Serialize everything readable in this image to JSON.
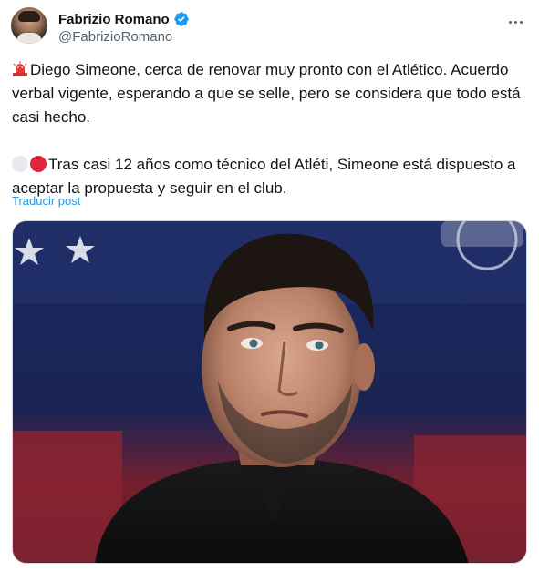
{
  "author": {
    "display_name": "Fabrizio Romano",
    "handle": "@FabrizioRomano",
    "verified": true
  },
  "tweet": {
    "paragraph_1": "Diego Simeone, cerca de renovar muy pronto con el Atlético. Acuerdo verbal vigente, esperando a que se selle, pero se considera que todo está casi hecho.",
    "paragraph_2": "Tras casi 12 años como técnico del Atléti, Simeone está dispuesto a aceptar la propuesta y seguir en el club.",
    "translate_label": "Traducir post"
  },
  "icons": {
    "verified": "verified-badge-icon",
    "more": "more-options-icon",
    "siren": "rotating-light-emoji",
    "white_circle": "white-circle-emoji",
    "red_circle": "red-circle-emoji"
  },
  "colors": {
    "link": "#1d9bf0",
    "verified": "#1d9bf0",
    "secondary_text": "#536471",
    "primary_text": "#0f1419"
  }
}
